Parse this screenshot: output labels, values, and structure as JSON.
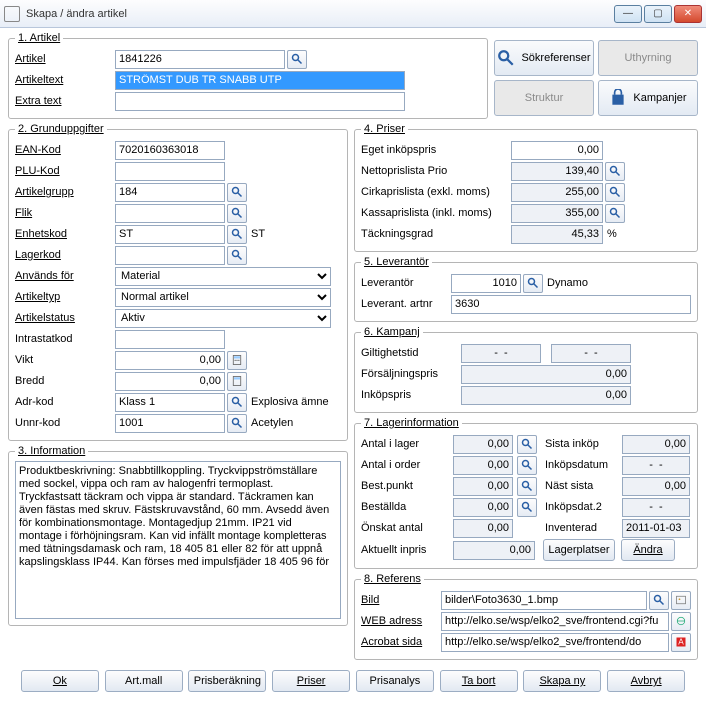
{
  "window": {
    "title": "Skapa / ändra artikel"
  },
  "section1": {
    "legend": "1. Artikel",
    "artikel_label": "Artikel",
    "artikel_value": "1841226",
    "artikeltext_label": "Artikeltext",
    "artikeltext_value": "STRÖMST DUB TR SNABB UTP",
    "extratext_label": "Extra text",
    "extratext_value": ""
  },
  "buttons": {
    "sokreferenser": "Sökreferenser",
    "uthyrning": "Uthyrning",
    "struktur": "Struktur",
    "kampanjer": "Kampanjer"
  },
  "section2": {
    "legend": "2. Grunduppgifter",
    "ean_label": "EAN-Kod",
    "ean_value": "7020160363018",
    "plu_label": "PLU-Kod",
    "plu_value": "",
    "artgrp_label": "Artikelgrupp",
    "artgrp_value": "184",
    "flik_label": "Flik",
    "flik_value": "",
    "enhet_label": "Enhetskod",
    "enhet_value": "ST",
    "enhet_after": "ST",
    "lager_label": "Lagerkod",
    "lager_value": "",
    "anvands_label": "Används för",
    "anvands_value": "Material",
    "artikeltyp_label": "Artikeltyp",
    "artikeltyp_value": "Normal artikel",
    "artstatus_label": "Artikelstatus",
    "artstatus_value": "Aktiv",
    "intrastat_label": "Intrastatkod",
    "intrastat_value": "",
    "vikt_label": "Vikt",
    "vikt_value": "0,00",
    "bredd_label": "Bredd",
    "bredd_value": "0,00",
    "adr_label": "Adr-kod",
    "adr_value": "Klass 1",
    "adr_after": "Explosiva ämne",
    "unnr_label": "Unnr-kod",
    "unnr_value": "1001",
    "unnr_after": "Acetylen"
  },
  "section3": {
    "legend": "3. Information",
    "text": "Produktbeskrivning: Snabbtillkoppling. Tryckvippströmställare med sockel, vippa och ram av halogenfri termoplast. Tryckfastsatt täckram och vippa är standard. Täckramen kan även fästas med skruv. Fästskruvavstånd, 60 mm. Avsedd även för kombinationsmontage. Montagedjup 21mm. IP21 vid montage i förhöjningsram. Kan vid infällt montage kompletteras med tätningsdamask och ram, 18 405 81 eller 82 för att uppnå kapslingsklass IP44. Kan förses med impulsfjäder 18 405 96 för"
  },
  "section4": {
    "legend": "4. Priser",
    "eget_label": "Eget inköpspris",
    "eget_value": "0,00",
    "netto_label": "Nettoprislista Prio",
    "netto_value": "139,40",
    "cirka_label": "Cirkaprislista (exkl. moms)",
    "cirka_value": "255,00",
    "kassa_label": "Kassaprislista (inkl. moms)",
    "kassa_value": "355,00",
    "tack_label": "Täckningsgrad",
    "tack_value": "45,33",
    "tack_unit": "%"
  },
  "section5": {
    "legend": "5. Leverantör",
    "lev_label": "Leverantör",
    "lev_value": "1010",
    "lev_name": "Dynamo",
    "levart_label": "Leverant. artnr",
    "levart_value": "3630"
  },
  "section6": {
    "legend": "6. Kampanj",
    "gilt_label": "Giltighetstid",
    "gilt_from": "-  -",
    "gilt_to": "-  -",
    "forsalj_label": "Försäljningspris",
    "forsalj_value": "0,00",
    "inkop_label": "Inköpspris",
    "inkop_value": "0,00"
  },
  "section7": {
    "legend": "7. Lagerinformation",
    "antal_lager_label": "Antal i lager",
    "antal_lager_value": "0,00",
    "sista_inkop_label": "Sista inköp",
    "sista_inkop_value": "0,00",
    "antal_order_label": "Antal i order",
    "antal_order_value": "0,00",
    "inkopsdatum_label": "Inköpsdatum",
    "inkopsdatum_value": "-  -",
    "bestpunkt_label": "Best.punkt",
    "bestpunkt_value": "0,00",
    "nast_sista_label": "Näst sista",
    "nast_sista_value": "0,00",
    "bestallda_label": "Beställda",
    "bestallda_value": "0,00",
    "inkopsdat2_label": "Inköpsdat.2",
    "inkopsdat2_value": "-  -",
    "onskat_label": "Önskat antal",
    "onskat_value": "0,00",
    "inventerad_label": "Inventerad",
    "inventerad_value": "2011-01-03",
    "aktuellt_label": "Aktuellt inpris",
    "aktuellt_value": "0,00",
    "lagerplatser_btn": "Lagerplatser",
    "andra_btn": "Ändra"
  },
  "section8": {
    "legend": "8. Referens",
    "bild_label": "Bild",
    "bild_value": "bilder\\Foto3630_1.bmp",
    "web_label": "WEB adress",
    "web_value": "http://elko.se/wsp/elko2_sve/frontend.cgi?fu",
    "acrobat_label": "Acrobat sida",
    "acrobat_value": "http://elko.se/wsp/elko2_sve/frontend/do"
  },
  "footer": {
    "ok": "Ok",
    "artmall": "Art.mall",
    "prisberakning": "Prisberäkning",
    "priser": "Priser",
    "prisanalys": "Prisanalys",
    "tabort": "Ta bort",
    "skapany": "Skapa ny",
    "avbryt": "Avbryt"
  }
}
